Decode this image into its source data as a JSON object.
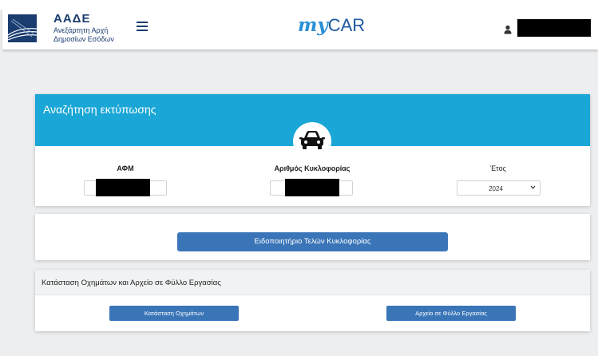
{
  "header": {
    "logo_title": "ΑΑΔΕ",
    "logo_sub_line1": "Ανεξάρτητη Αρχή",
    "logo_sub_line2": "Δημοσίων Εσόδων",
    "brand_my": "my",
    "brand_car": "CAR",
    "icons": [
      "aade-logo-icon",
      "hamburger-menu-icon",
      "user-icon"
    ]
  },
  "search": {
    "title": "Αναζήτηση εκτύπωσης",
    "icon": "car-icon",
    "afm_label": "ΑΦΜ",
    "plate_label": "Αριθμός Κυκλοφορίας",
    "year_label": "Έτος",
    "year_value": "2024"
  },
  "notice": {
    "button_label": "Ειδοποιητήριο Τελών Κυκλοφορίας"
  },
  "vehicles": {
    "title": "Κατάσταση Οχημάτων και Αρχείο σε Φύλλο Εργασίας",
    "status_button": "Κατάσταση Οχημάτων",
    "spreadsheet_button": "Αρχείο σε Φύλλο Εργασίας"
  },
  "colors": {
    "header_blue": "#1aa6d6",
    "button_blue": "#3a75b8",
    "brand_navy": "#1a3c6e"
  }
}
